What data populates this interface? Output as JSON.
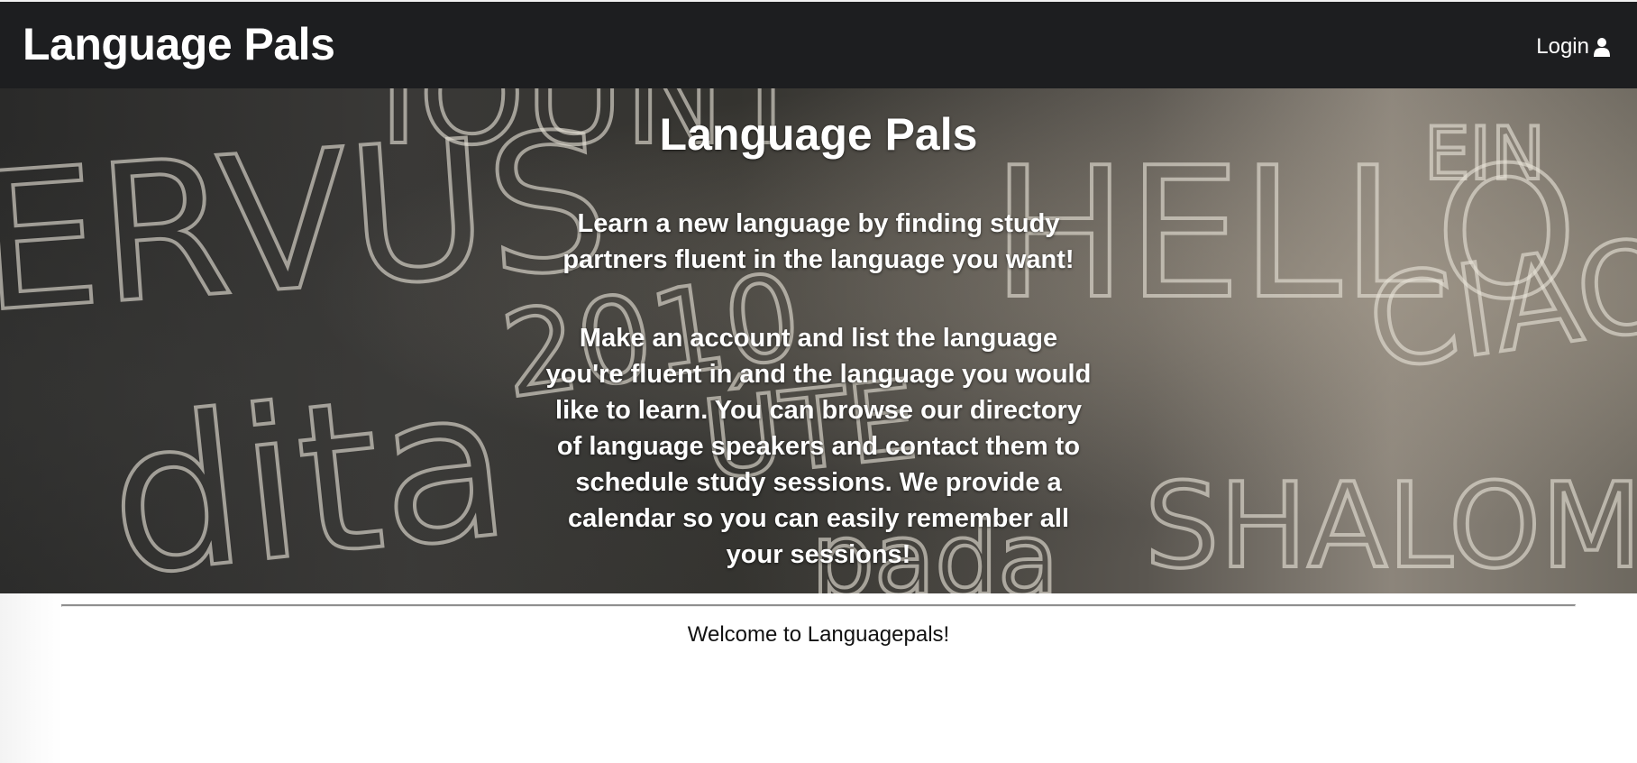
{
  "navbar": {
    "brand": "Language Pals",
    "login_label": "Login",
    "login_icon": "user-icon",
    "background": "#1d1e20"
  },
  "hero": {
    "title": "Language Pals",
    "paragraph1": "Learn a new language by finding study partners fluent in the language you want!",
    "paragraph2": "Make an account and list the language you're fluent in and the language you would like to learn. You can browse our directory of language speakers and contact them to schedule study sessions. We provide a calendar so you can easily remember all your sessions!",
    "background_image": "chalkboard with greetings in many languages"
  },
  "main": {
    "welcome": "Welcome to Languagepals!"
  }
}
